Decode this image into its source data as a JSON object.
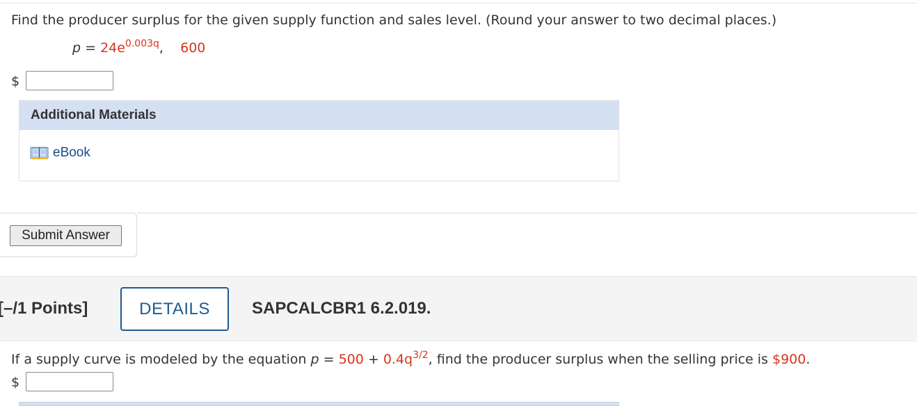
{
  "question1": {
    "prompt": "Find the producer surplus for the given supply function and sales level. (Round your answer to two decimal places.)",
    "equation": {
      "var": "p",
      "equals": " = ",
      "base": "24e",
      "exponent": "0.003q",
      "comma": ",",
      "level": "600"
    },
    "currency": "$",
    "answer_value": ""
  },
  "additional_materials": {
    "title": "Additional Materials",
    "ebook_label": "eBook"
  },
  "submit": {
    "label": "Submit Answer"
  },
  "question2_header": {
    "points": "[–/1 Points]",
    "details_label": "DETAILS",
    "question_id": "SAPCALCBR1 6.2.019."
  },
  "question2": {
    "prompt_start": "If a supply curve is modeled by the equation ",
    "var": "p",
    "equals": " = ",
    "term1": "500",
    "plus": " + ",
    "term2": "0.4q",
    "exponent": "3/2",
    "prompt_mid": ", find the producer surplus when the selling price is ",
    "price": "$900",
    "prompt_end": ".",
    "currency": "$",
    "answer_value": ""
  },
  "colors": {
    "accent_red": "#d9341c",
    "link_blue": "#1a4c8c",
    "details_blue": "#1f5a8f",
    "materials_header_bg": "#d6e0f3"
  }
}
